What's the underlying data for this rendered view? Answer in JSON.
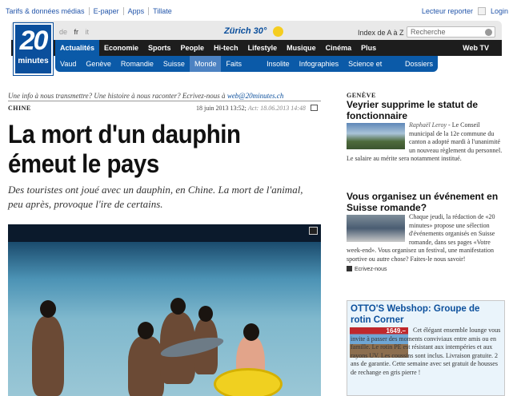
{
  "topbar": {
    "links": [
      "Tarifs & données médias",
      "E-paper",
      "Apps",
      "Tillate"
    ],
    "reporter": "Lecteur reporter",
    "login": "Login"
  },
  "header": {
    "logo_number": "20",
    "logo_word": "minutes",
    "languages": [
      "de",
      "fr",
      "it"
    ],
    "active_language": "fr",
    "weather": "Zürich 30°",
    "index_label": "Index de A à Z",
    "search_placeholder": "Recherche"
  },
  "nav": {
    "primary": [
      "Actualités",
      "Economie",
      "Sports",
      "People",
      "Hi-tech",
      "Lifestyle",
      "Musique",
      "Cinéma",
      "Plus"
    ],
    "primary_active": "Actualités",
    "web_tv": "Web TV",
    "secondary": [
      "Vaud",
      "Genève",
      "Romandie",
      "Suisse",
      "Monde",
      "Faits divers",
      "Insolite",
      "Infographies",
      "Science et nature",
      "Dossiers"
    ],
    "secondary_active": "Monde"
  },
  "article": {
    "tip_text": "Une info à nous transmettre? Une histoire à nous raconter? Ecrivez-nous à",
    "tip_email": "web@20minutes.ch",
    "section": "CHINE",
    "date": "18 juin 2013 13:52;",
    "updated": "Act: 18.06.2013 14:48",
    "title": "La mort d'un dauphin émeut le pays",
    "lead": "Des touristes ont joué avec un dauphin, en Chine. La mort de l'animal, peu après, provoque l'ire de certains."
  },
  "sidebar": {
    "story1": {
      "kicker": "GENÈVE",
      "title": "Veyrier supprime le statut de fonctionnaire",
      "author": "Raphaël Leroy",
      "body": " - Le Conseil municipal de la 12e commune du canton a adopté mardi à l'unanimité un nouveau règlement du personnel. Le salaire au mérite sera notamment institué."
    },
    "story2": {
      "title": "Vous organisez un événement en Suisse romande?",
      "body": "Chaque jeudi, la rédaction de «20 minutes» propose une sélection d'événements organisés en Suisse romande, dans ses pages «Votre week-end». Vous organisez un festival, une manifestation sportive ou autre chose? Faites-le nous savoir!",
      "vote": "Ecrivez-nous"
    },
    "promo": {
      "title": "OTTO'S Webshop: Groupe de rotin Corner",
      "price": "1649.–",
      "body": "Cet élégant ensemble lounge vous invite à passer des moments conviviaux entre amis ou en famille. Le rotin PE est résistant aux intempéries et aux rayons UV. Les coussins sont inclus. Livraison gratuite. 2 ans de garantie. Cette semaine avec set gratuit de housses de rechange en gris pierre !"
    }
  }
}
